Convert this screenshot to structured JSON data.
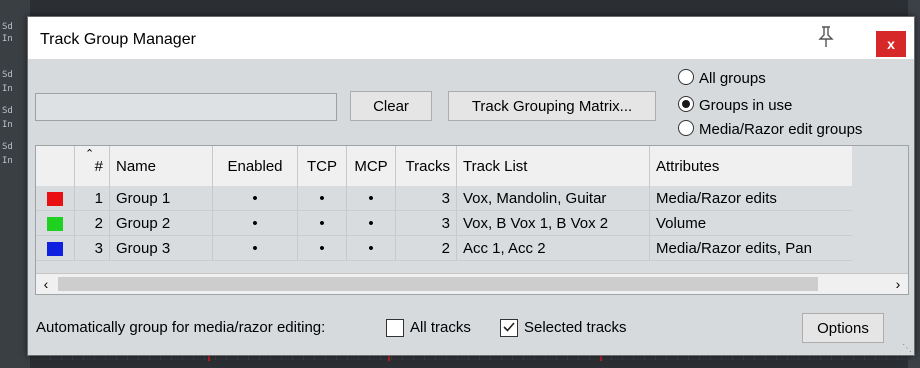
{
  "window": {
    "title": "Track Group Manager",
    "pin_icon": "pin-icon",
    "close_label": "x"
  },
  "toolbar": {
    "filter_value": "",
    "clear_label": "Clear",
    "matrix_label": "Track Grouping Matrix..."
  },
  "view_options": [
    {
      "label": "All groups",
      "selected": false
    },
    {
      "label": "Groups in use",
      "selected": true
    },
    {
      "label": "Media/Razor edit groups",
      "selected": false
    }
  ],
  "table": {
    "columns": [
      "",
      "#",
      "Name",
      "Enabled",
      "TCP",
      "MCP",
      "Tracks",
      "Track List",
      "Attributes"
    ],
    "rows": [
      {
        "color": "#e81010",
        "num": "1",
        "name": "Group 1",
        "enabled": "•",
        "tcp": "•",
        "mcp": "•",
        "tracks": "3",
        "track_list": "Vox, Mandolin, Guitar",
        "attributes": "Media/Razor edits"
      },
      {
        "color": "#20d020",
        "num": "2",
        "name": "Group 2",
        "enabled": "•",
        "tcp": "•",
        "mcp": "•",
        "tracks": "3",
        "track_list": "Vox, B Vox 1,  B Vox 2",
        "attributes": "Volume"
      },
      {
        "color": "#1020e0",
        "num": "3",
        "name": "Group 3",
        "enabled": "•",
        "tcp": "•",
        "mcp": "•",
        "tracks": "2",
        "track_list": "Acc 1, Acc 2",
        "attributes": "Media/Razor edits, Pan"
      }
    ]
  },
  "footer": {
    "auto_group_label": "Automatically group for media/razor editing:",
    "all_tracks_label": "All tracks",
    "all_tracks_checked": false,
    "selected_tracks_label": "Selected tracks",
    "selected_tracks_checked": true,
    "options_label": "Options"
  }
}
